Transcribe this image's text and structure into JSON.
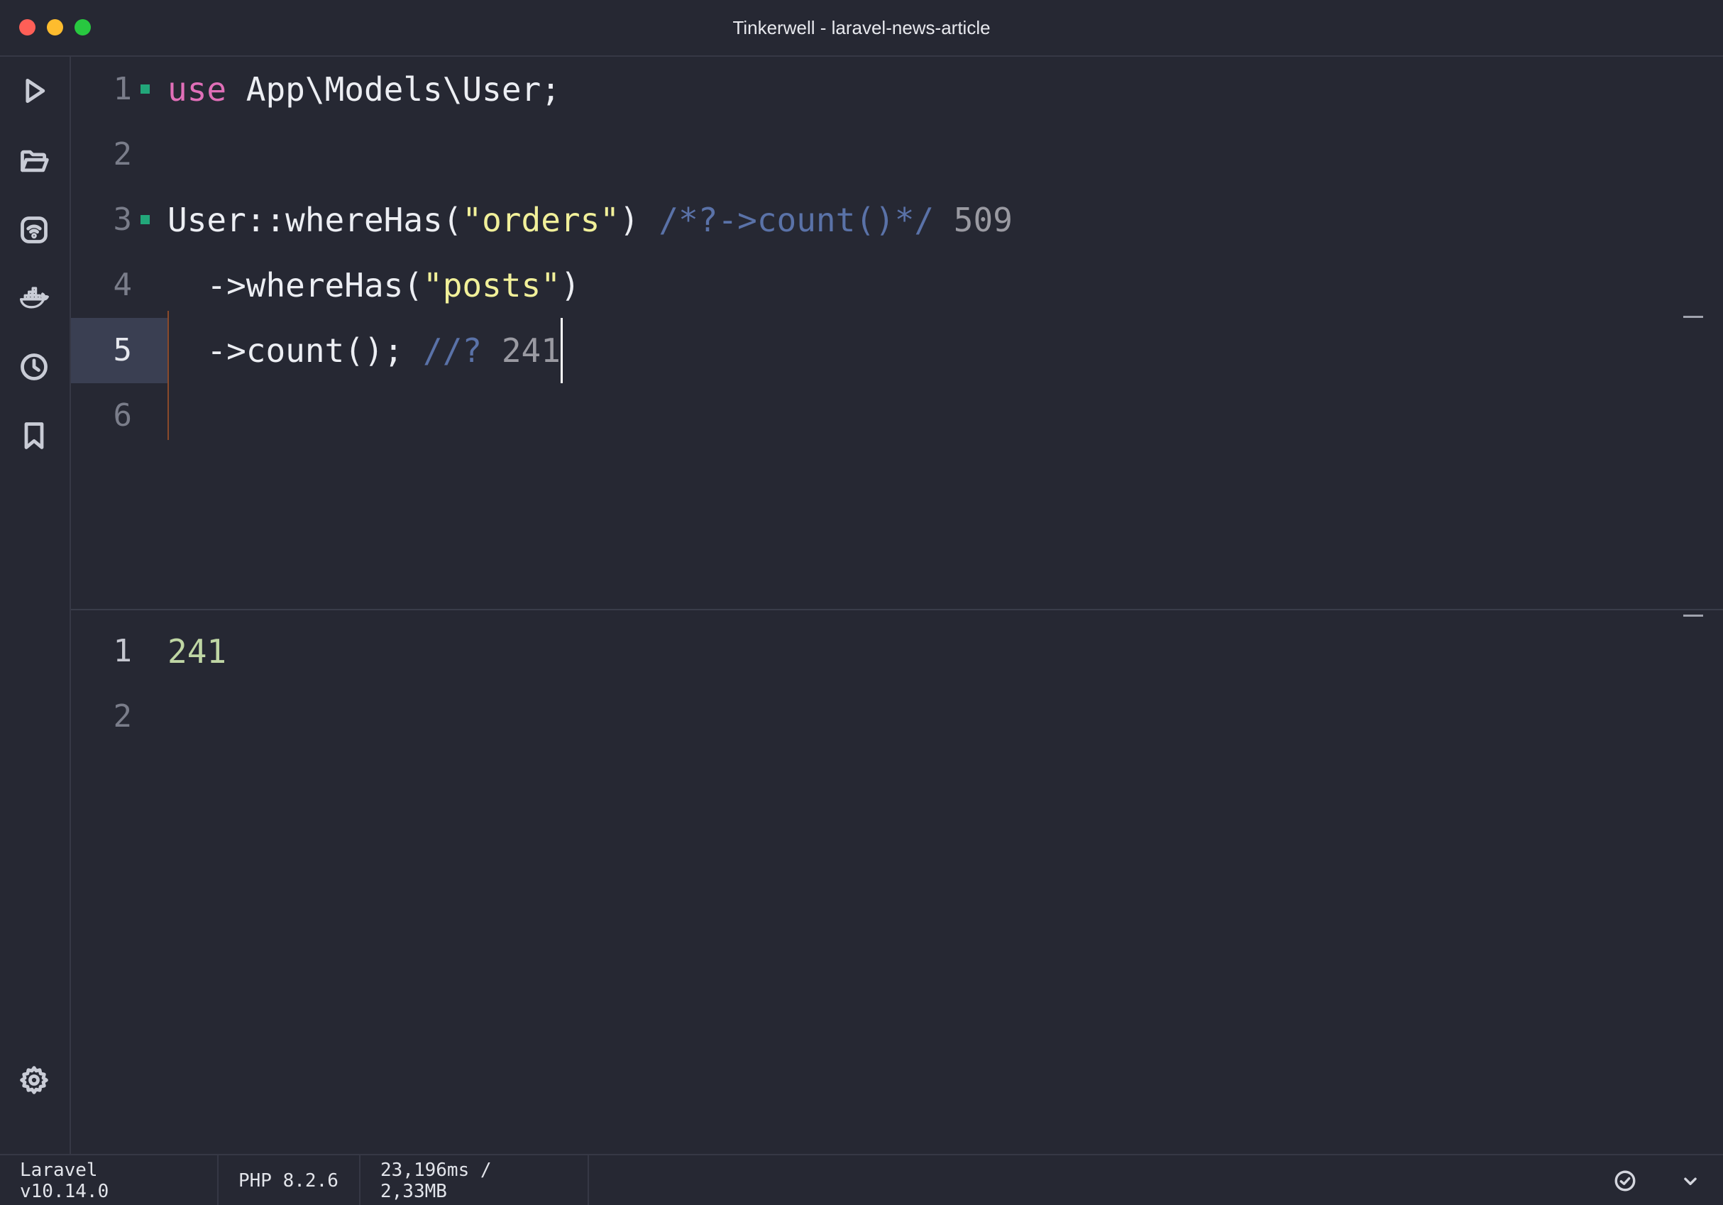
{
  "window": {
    "title": "Tinkerwell - laravel-news-article"
  },
  "sidebar": {
    "items": [
      {
        "icon": "play-icon"
      },
      {
        "icon": "folder-open-icon"
      },
      {
        "icon": "remote-connection-icon"
      },
      {
        "icon": "docker-icon"
      },
      {
        "icon": "history-clock-icon"
      },
      {
        "icon": "bookmark-icon"
      },
      {
        "icon": "gear-icon"
      }
    ]
  },
  "editor": {
    "lines": [
      {
        "number": "1",
        "keyword": "use",
        "text": " App\\Models\\User;"
      },
      {
        "number": "2"
      },
      {
        "number": "3",
        "text_a": "User::whereHas(",
        "string": "\"orders\"",
        "text_b": ") ",
        "comment": "/*?->count()*/",
        "result": " 509"
      },
      {
        "number": "4",
        "text_a": "  ->whereHas(",
        "string": "\"posts\"",
        "text_b": ")"
      },
      {
        "number": "5",
        "text_a": "  ->count(); ",
        "comment": "//?",
        "result": " 241"
      },
      {
        "number": "6"
      }
    ]
  },
  "output": {
    "lines": [
      {
        "number": "1",
        "value": "241"
      },
      {
        "number": "2"
      }
    ]
  },
  "statusbar": {
    "framework": "Laravel v10.14.0",
    "php": "PHP 8.2.6",
    "metrics": "23,196ms / 2,33MB"
  },
  "colors": {
    "background": "#262833",
    "keyword": "#e06fb8",
    "string": "#f1f09a",
    "comment": "#5a72a8",
    "marker": "#22a77a"
  }
}
